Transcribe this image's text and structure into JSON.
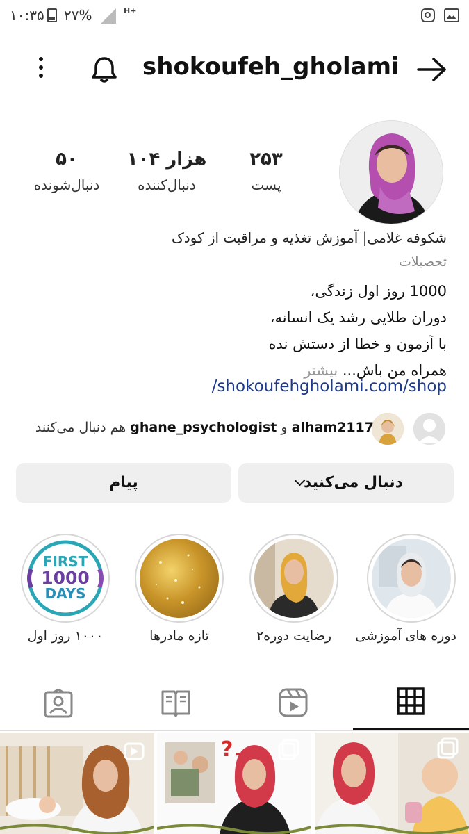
{
  "status_bar": {
    "time": "۱۰:۳۵",
    "battery": "۲۷%",
    "network": "H+"
  },
  "header": {
    "username": "shokoufeh_gholami"
  },
  "stats": {
    "posts": {
      "value": "۲۵۳",
      "label": "پست"
    },
    "followers": {
      "value": "۱۰۴ هزار",
      "label": "دنبال‌کننده"
    },
    "following": {
      "value": "۵۰",
      "label": "دنبال‌شونده"
    }
  },
  "bio": {
    "title": "شکوفه غلامی| آموزش تغذیه و مراقبت از کودک",
    "category": "تحصیلات",
    "line1": "1000 روز اول زندگی،",
    "line2": "دوران طلایی رشد یک انسانه،",
    "line3": "با آزمون و خطا از دستش نده",
    "line4": "همراه من باش...",
    "more": " بیشتر",
    "link": "/shokoufehgholami.com/shop"
  },
  "followed_by": {
    "user1": "alham2117",
    "and": " و ",
    "user2": "ghane_psychologist",
    "suffix": " هم دنبال می‌کنند"
  },
  "buttons": {
    "following": "دنبال می‌کنید",
    "message": "پیام"
  },
  "highlights": [
    {
      "label": "دوره های آموزشی"
    },
    {
      "label": "رضایت دوره۲"
    },
    {
      "label": "تازه مادرها"
    },
    {
      "label": "۱۰۰۰ روز اول",
      "art_line1": "FIRST",
      "art_line2": "1000",
      "art_line3": "DAYS"
    }
  ],
  "colors": {
    "accent_link": "#1e3a8a",
    "button_bg": "#efefef",
    "highlight_ring": "#d7d7d7"
  }
}
